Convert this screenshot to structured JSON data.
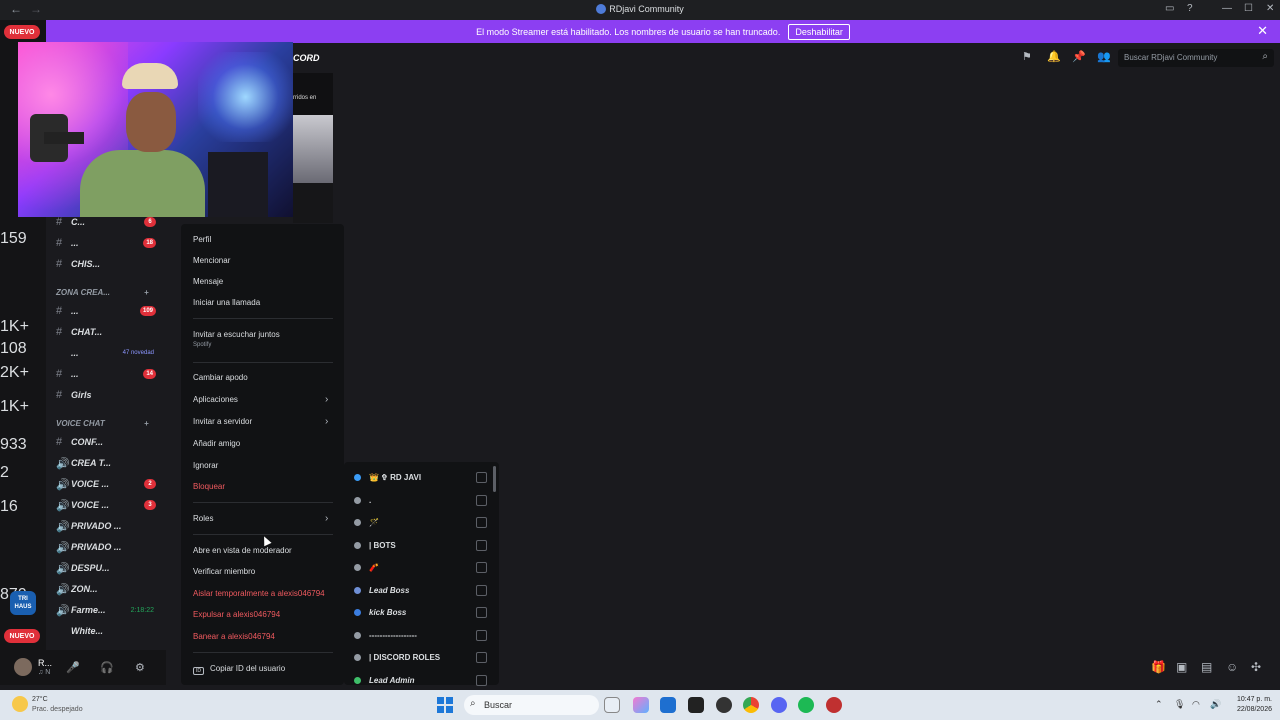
{
  "window": {
    "title": "RDjavi Community",
    "back": "←",
    "forward": "→",
    "ctrl_min": "—",
    "ctrl_max": "☐",
    "ctrl_close": "✕"
  },
  "banner": {
    "text": "El modo Streamer está habilitado. Los nombres de usuario se han truncado.",
    "button": "Deshabilitar",
    "close": "✕"
  },
  "badges": {
    "nuevo_top": "NUEVO",
    "nuevo_bottom": "NUEVO"
  },
  "server_rail": [
    {
      "badge": "159"
    },
    {
      "badge": ""
    },
    {
      "badge": ""
    },
    {
      "badge": ""
    },
    {
      "badge": "1K+"
    },
    {
      "badge": "108"
    },
    {
      "badge": "2K+"
    },
    {
      "badge": "1K+"
    },
    {
      "badge": "933"
    },
    {
      "badge": "2"
    },
    {
      "badge": "16"
    },
    {
      "badge": ""
    },
    {
      "badge": ""
    },
    {
      "badge": "870"
    },
    {
      "badge": ""
    }
  ],
  "server_rail_tile": "TRI HAUS",
  "channel_header": {
    "name": "CORD"
  },
  "thumb": {
    "text": "rridos en"
  },
  "toolbar": {
    "search_placeholder": "Buscar RDjavi Community"
  },
  "channels": [
    {
      "icon": "#",
      "name": "C...",
      "count": "6"
    },
    {
      "icon": "#",
      "name": "...",
      "count": "18"
    },
    {
      "icon": "#",
      "name": "CHIS...",
      "count": ""
    },
    {
      "icon": "",
      "name": "ZONA CREA...",
      "count": "",
      "category": true
    },
    {
      "icon": "#",
      "name": "...",
      "count": "109"
    },
    {
      "icon": "#",
      "name": "CHAT...",
      "count": ""
    },
    {
      "icon": "",
      "name": "...",
      "count": "",
      "novedad": "47 novedad"
    },
    {
      "icon": "#",
      "name": "...",
      "count": "14"
    },
    {
      "icon": "#",
      "name": "Girls",
      "count": ""
    },
    {
      "icon": "",
      "name": "VOICE CHAT",
      "count": "",
      "category": true
    },
    {
      "icon": "#",
      "name": "CONF...",
      "count": ""
    },
    {
      "icon": "🔊",
      "name": "CREA T...",
      "count": ""
    },
    {
      "icon": "🔊",
      "name": "VOICE ...",
      "count": "2"
    },
    {
      "icon": "🔊",
      "name": "VOICE ...",
      "count": "3"
    },
    {
      "icon": "🔊",
      "name": "PRIVADO ...",
      "count": ""
    },
    {
      "icon": "🔊",
      "name": "PRIVADO ...",
      "count": ""
    },
    {
      "icon": "🔊",
      "name": "DESPU...",
      "count": ""
    },
    {
      "icon": "🔊",
      "name": "ZON...",
      "count": ""
    },
    {
      "icon": "🔊",
      "name": "Farme...",
      "count": "",
      "time": "2:18:22"
    },
    {
      "icon": "",
      "name": "White...",
      "count": ""
    }
  ],
  "context_menu": {
    "perfil": "Perfil",
    "mencionar": "Mencionar",
    "mensaje": "Mensaje",
    "llamada": "Iniciar una llamada",
    "escuchar": "Invitar a escuchar juntos",
    "escuchar_sub": "Spotify",
    "apodo": "Cambiar apodo",
    "aplicaciones": "Aplicaciones",
    "invitar_servidor": "Invitar a servidor",
    "amigo": "Añadir amigo",
    "ignorar": "Ignorar",
    "bloquear": "Bloquear",
    "roles": "Roles",
    "moderador": "Abre en vista de moderador",
    "verificar": "Verificar miembro",
    "aislar": "Aislar temporalmente a alexis046794",
    "expulsar": "Expulsar a alexis046794",
    "banear": "Banear a alexis046794",
    "copiar_id": "Copiar ID del usuario"
  },
  "roles_submenu": [
    {
      "label": "👑 ✞ RD JAVI",
      "color": "#3b9cf7",
      "italic": false
    },
    {
      "label": ".",
      "color": "#949ba4",
      "italic": false
    },
    {
      "label": "🪄",
      "color": "#949ba4",
      "italic": false
    },
    {
      "label": "| BOTS",
      "color": "#949ba4",
      "italic": false
    },
    {
      "label": "🧨",
      "color": "#949ba4",
      "italic": false
    },
    {
      "label": "Lead Boss",
      "color": "#6f8fd6",
      "italic": true
    },
    {
      "label": "kick Boss",
      "color": "#3b7de0",
      "italic": true
    },
    {
      "label": "------------------",
      "color": "#949ba4",
      "italic": false
    },
    {
      "label": "| DISCORD ROLES",
      "color": "#949ba4",
      "italic": false
    },
    {
      "label": "Lead Admin",
      "color": "#3fbf6a",
      "italic": true
    }
  ],
  "user_panel": {
    "name": "R...",
    "status": "♫ N"
  },
  "taskbar": {
    "temp": "27°C",
    "condition": "Prac. despejado",
    "search": "Buscar",
    "time": "10:47 p. m.",
    "date": "22/08/2026"
  }
}
